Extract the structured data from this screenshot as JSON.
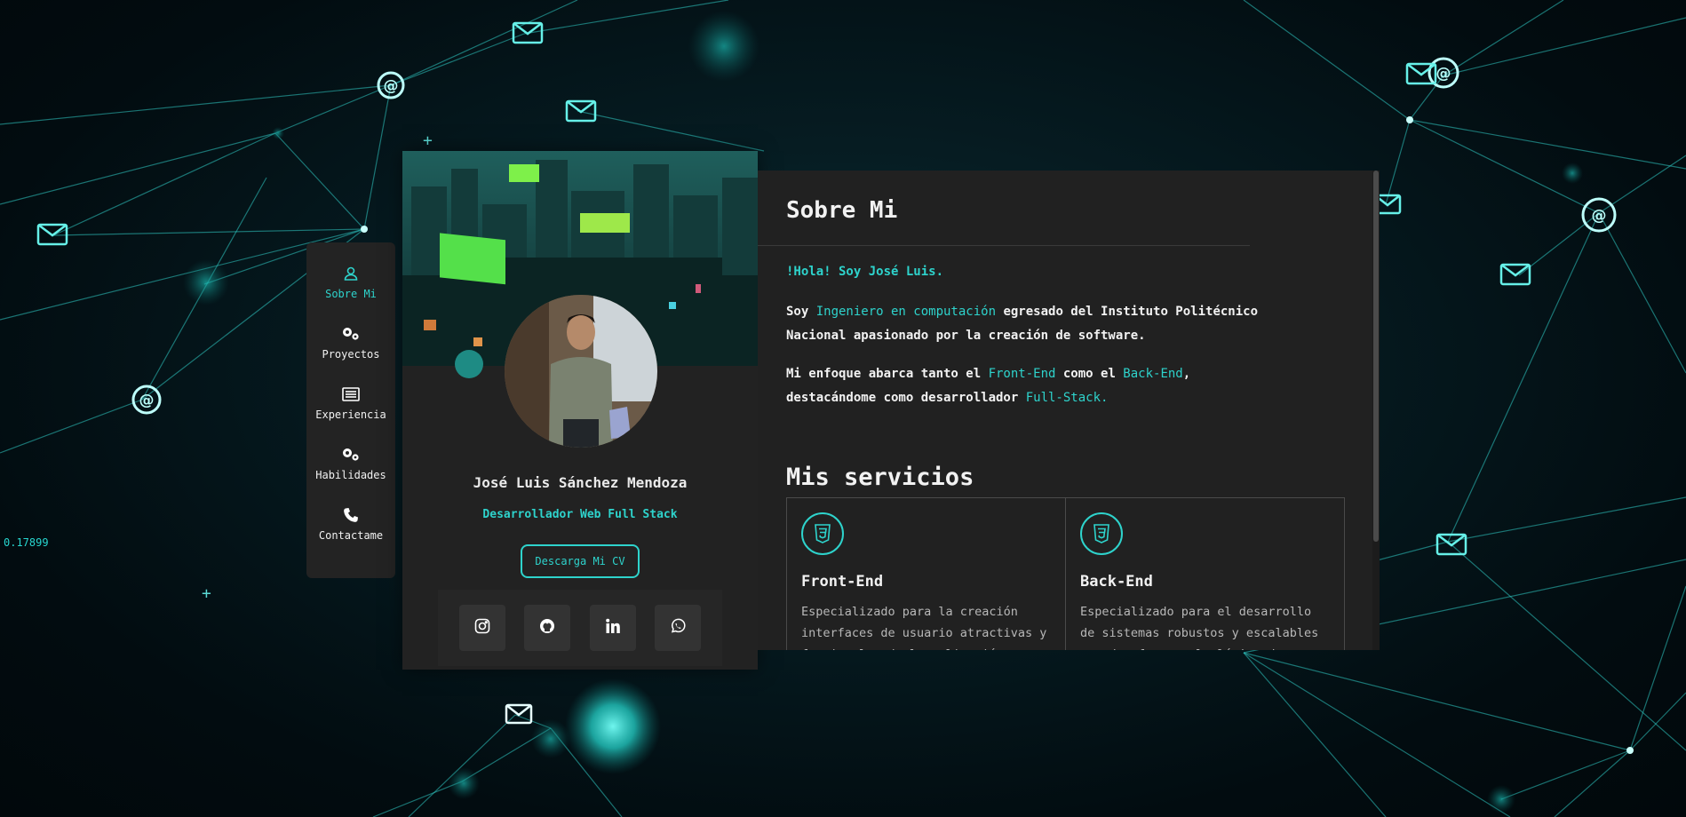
{
  "background": {
    "ticker_text": "0.17899",
    "accent": "#2ed3cc",
    "icons": [
      "mail-icon",
      "at-sign-icon"
    ]
  },
  "sidebar": {
    "items": [
      {
        "label": "Sobre Mi",
        "icon": "user-icon",
        "active": true
      },
      {
        "label": "Proyectos",
        "icon": "gears-icon",
        "active": false
      },
      {
        "label": "Experiencia",
        "icon": "list-icon",
        "active": false
      },
      {
        "label": "Habilidades",
        "icon": "gears-icon",
        "active": false
      },
      {
        "label": "Contactame",
        "icon": "phone-icon",
        "active": false
      }
    ]
  },
  "profile": {
    "name": "José Luis Sánchez Mendoza",
    "role": "Desarrollador Web Full Stack",
    "cv_button": "Descarga Mi CV",
    "socials": [
      "instagram-icon",
      "github-icon",
      "linkedin-icon",
      "whatsapp-icon"
    ]
  },
  "about": {
    "title": "Sobre Mi",
    "greeting": "!Hola! Soy José Luis.",
    "p1": {
      "t1": "Soy ",
      "h1": "Ingeniero en computación",
      "t2": " egresado del Instituto Politécnico Nacional apasionado por la creación de software."
    },
    "p2": {
      "t1": "Mi enfoque abarca tanto el ",
      "h1": "Front-End",
      "t2": " como el ",
      "h2": "Back-End",
      "t3": ", destacándome como desarrollador ",
      "h3": "Full-Stack."
    }
  },
  "services": {
    "title": "Mis servicios",
    "items": [
      {
        "title": "Front-End",
        "icon": "css3-icon",
        "desc": "Especializado para la creación interfaces de usuario atractivas y funcionales de la aplicación"
      },
      {
        "title": "Back-End",
        "icon": "css3-icon",
        "desc": "Especializado para el desarrollo de sistemas robustos y escalables que dan forma a la lógica de"
      }
    ]
  }
}
